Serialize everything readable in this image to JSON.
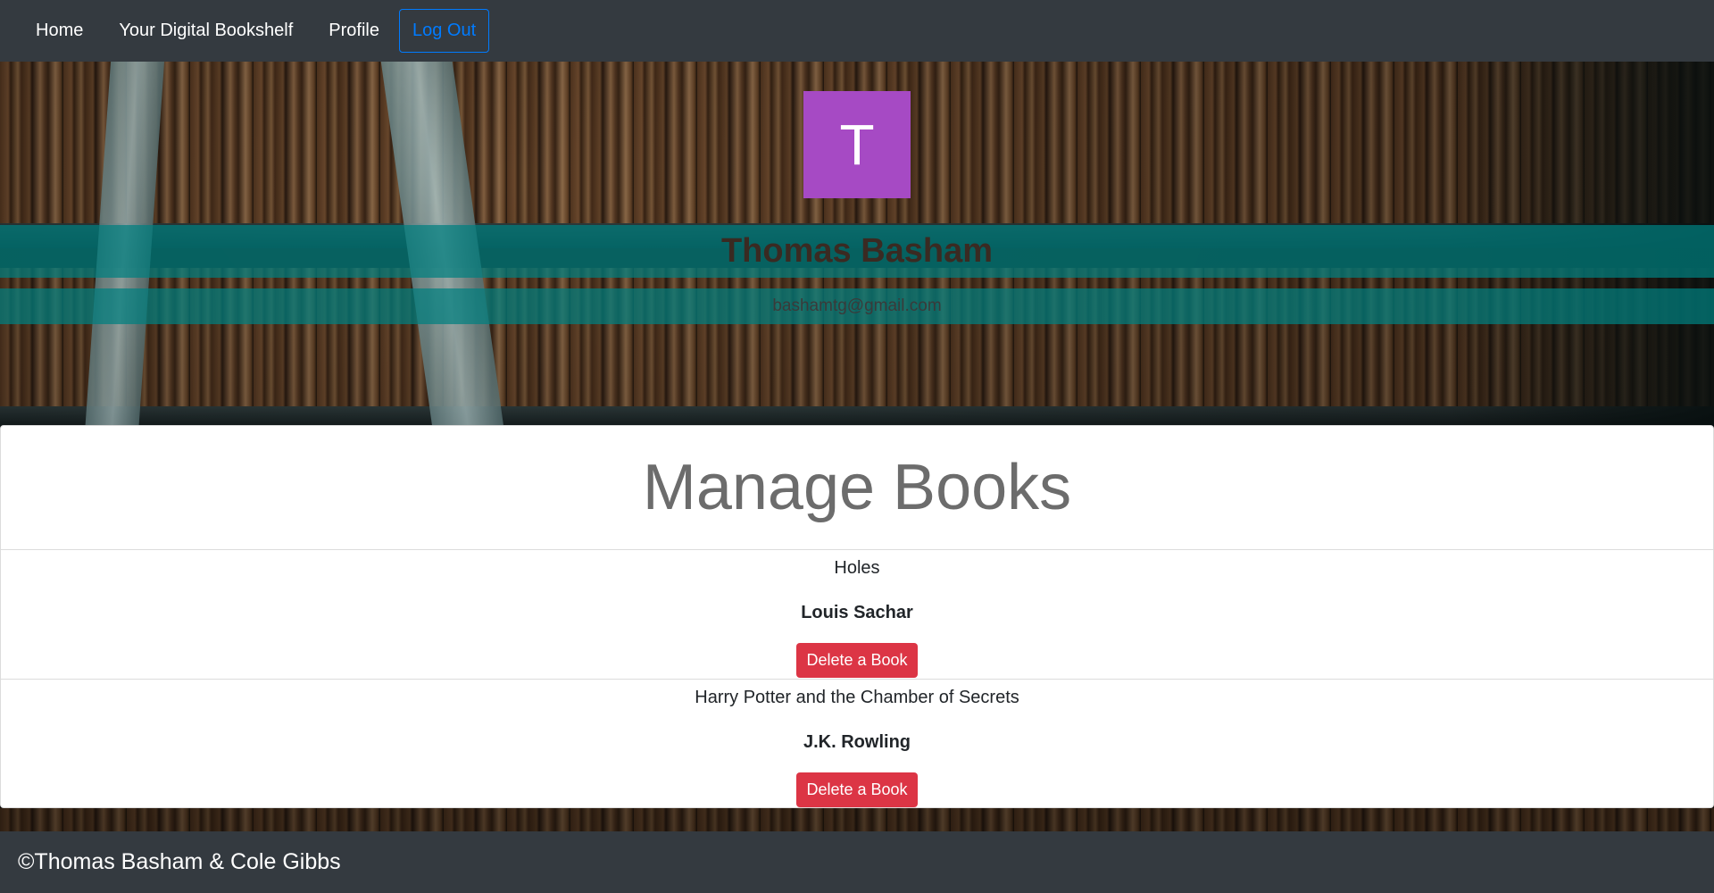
{
  "nav": {
    "home": "Home",
    "bookshelf": "Your Digital Bookshelf",
    "profile": "Profile",
    "logout": "Log Out"
  },
  "profile": {
    "avatar_letter": "T",
    "avatar_color": "#a64ac4",
    "name": "Thomas Basham",
    "email": "bashamtg@gmail.com"
  },
  "manage": {
    "title": "Manage Books",
    "books": [
      {
        "title": "Holes",
        "author": "Louis Sachar",
        "delete_label": "Delete a Book"
      },
      {
        "title": "Harry Potter and the Chamber of Secrets",
        "author": "J.K. Rowling",
        "delete_label": "Delete a Book"
      }
    ]
  },
  "footer": {
    "text": "©Thomas Basham & Cole Gibbs"
  },
  "colors": {
    "navbar": "#343a40",
    "accent_link": "#007bff",
    "band": "#008080",
    "danger": "#dc3545"
  }
}
